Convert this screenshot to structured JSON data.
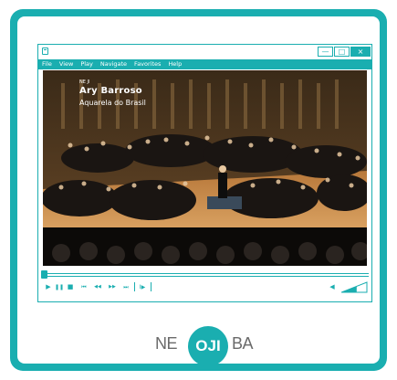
{
  "menu": {
    "items": [
      "File",
      "View",
      "Play",
      "Navigate",
      "Favorites",
      "Help"
    ]
  },
  "window": {
    "minimize_glyph": "—",
    "maximize_glyph": "□",
    "close_glyph": "×"
  },
  "video": {
    "logo_text": "NE JI",
    "title": "Ary Barroso",
    "subtitle": "Aquarela do Brasil",
    "progress": 0.01
  },
  "controls": {
    "play": "▶",
    "pause": "❚❚",
    "stop": "■",
    "prev": "⏮",
    "rewind": "◀◀",
    "forward": "▶▶",
    "next": "⏭",
    "step": "I▶",
    "volume_icon": "◀",
    "volume_level": 0.6
  },
  "brand": {
    "left": "NE",
    "center": "OJI",
    "right": "BA",
    "accent": "#1aaeb0"
  }
}
